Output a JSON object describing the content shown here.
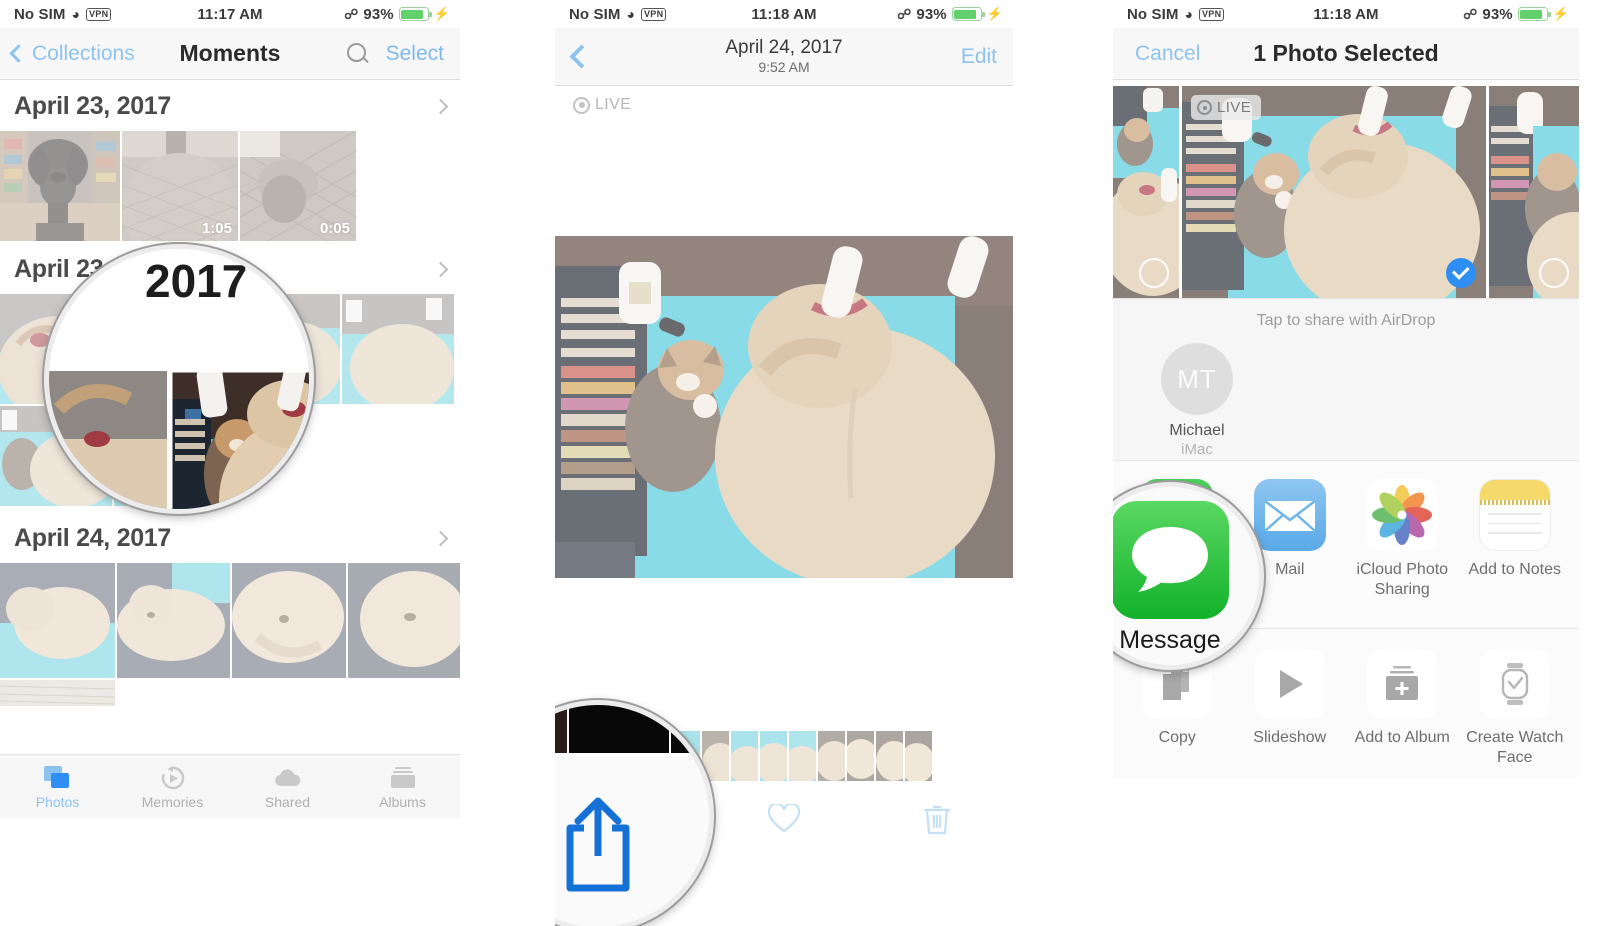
{
  "panels": {
    "left": {
      "status": {
        "carrier": "No SIM",
        "wifi_icon": "wifi-icon",
        "vpn": "VPN",
        "time": "11:17 AM",
        "bluetooth_icon": "bluetooth-icon",
        "battery_percent": "93%",
        "charging_icon": "charging-bolt-icon"
      },
      "nav": {
        "back_label": "Collections",
        "title": "Moments",
        "search_icon": "search-icon",
        "select_label": "Select"
      },
      "moments": [
        {
          "date": "April 23, 2017",
          "chevron": "chevron-right-icon",
          "durations": [
            "",
            "1:05",
            "0:05"
          ]
        },
        {
          "date": "April 23, 2017",
          "chevron": "chevron-right-icon",
          "durations": []
        },
        {
          "date": "April 24, 2017",
          "chevron": "chevron-right-icon",
          "durations": []
        }
      ],
      "tabs": [
        {
          "label": "Photos",
          "icon": "photos-icon",
          "active": true
        },
        {
          "label": "Memories",
          "icon": "memories-icon",
          "active": false
        },
        {
          "label": "Shared",
          "icon": "shared-cloud-icon",
          "active": false
        },
        {
          "label": "Albums",
          "icon": "albums-icon",
          "active": false
        }
      ],
      "loupe_text": "2017"
    },
    "mid": {
      "status": {
        "carrier": "No SIM",
        "wifi_icon": "wifi-icon",
        "vpn": "VPN",
        "time": "11:18 AM",
        "bluetooth_icon": "bluetooth-icon",
        "battery_percent": "93%",
        "charging_icon": "charging-bolt-icon"
      },
      "nav": {
        "back_icon": "chevron-back-icon",
        "title": "April 24, 2017",
        "subtitle": "9:52 AM",
        "edit_label": "Edit"
      },
      "live_badge": "LIVE",
      "toolbar": {
        "share_icon": "share-icon",
        "favorite_icon": "heart-icon",
        "delete_icon": "trash-icon"
      }
    },
    "right": {
      "status": {
        "carrier": "No SIM",
        "wifi_icon": "wifi-icon",
        "vpn": "VPN",
        "time": "11:18 AM",
        "bluetooth_icon": "bluetooth-icon",
        "battery_percent": "93%",
        "charging_icon": "charging-bolt-icon"
      },
      "nav": {
        "cancel_label": "Cancel",
        "title": "1 Photo Selected"
      },
      "live_tag": "LIVE",
      "airdrop": {
        "hint": "Tap to share with AirDrop",
        "person_initials": "MT",
        "person_name": "Michael",
        "person_device": "iMac"
      },
      "share_apps": [
        {
          "label": "Message",
          "icon": "messages-app-icon"
        },
        {
          "label": "Mail",
          "icon": "mail-app-icon"
        },
        {
          "label": "iCloud Photo Sharing",
          "icon": "icloud-photo-sharing-icon"
        },
        {
          "label": "Add to Notes",
          "icon": "notes-app-icon"
        }
      ],
      "share_actions": [
        {
          "label": "Copy",
          "icon": "copy-icon"
        },
        {
          "label": "Slideshow",
          "icon": "play-icon"
        },
        {
          "label": "Add to Album",
          "icon": "add-to-album-icon"
        },
        {
          "label": "Create Watch Face",
          "icon": "watch-face-icon"
        }
      ]
    }
  },
  "colors": {
    "accent_blue": "#2f8ef4",
    "tint_blue": "#8fc3ef",
    "imessage_green": "#21c12f",
    "battery_green": "#63d16b"
  }
}
